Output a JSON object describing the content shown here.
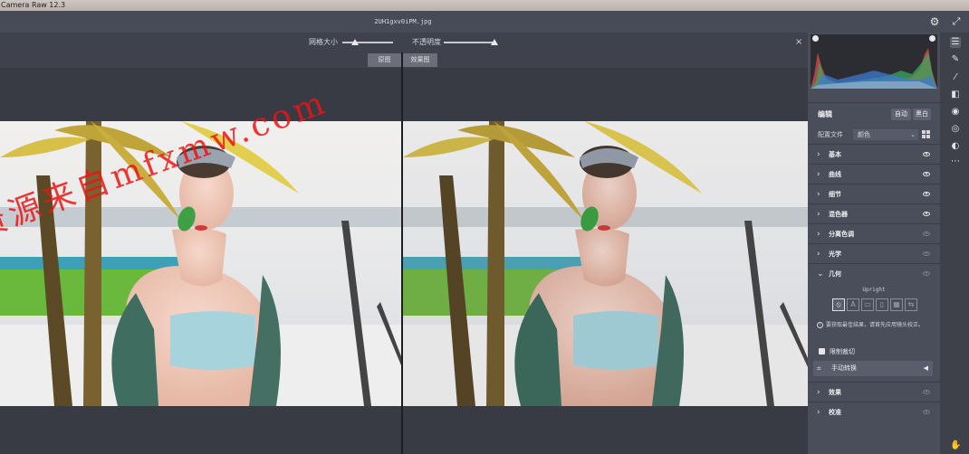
{
  "window": {
    "title": "Camera Raw 12.3",
    "filename": "2UH1gxv0iPM.jpg"
  },
  "header_icons": {
    "settings": "gear-icon",
    "fullscreen": "expand-icon"
  },
  "compare_bar": {
    "grid_size_label": "网格大小",
    "grid_size_value": 0.25,
    "opacity_label": "不透明度",
    "opacity_value": 1.0,
    "close_glyph": "×"
  },
  "view_buttons": {
    "before": "原图",
    "after": "效果图"
  },
  "watermark": "资源来自mfxmw.com",
  "edit_panel": {
    "title": "编辑",
    "auto_button": "自动",
    "bw_button": "黑白",
    "profile_label": "配置文件",
    "profile_value": "颜色",
    "sections": [
      {
        "label": "基本",
        "expanded": false,
        "visible": true
      },
      {
        "label": "曲线",
        "expanded": false,
        "visible": true
      },
      {
        "label": "细节",
        "expanded": false,
        "visible": true
      },
      {
        "label": "混色器",
        "expanded": false,
        "visible": true
      },
      {
        "label": "分离色调",
        "expanded": false,
        "visible": false
      },
      {
        "label": "光学",
        "expanded": false,
        "visible": false
      },
      {
        "label": "几何",
        "expanded": true,
        "visible": false
      },
      {
        "label": "效果",
        "expanded": false,
        "visible": false
      },
      {
        "label": "校准",
        "expanded": false,
        "visible": false
      }
    ],
    "geometry": {
      "upright_label": "Upright",
      "upright_buttons": [
        "⦸",
        "A",
        "▭",
        "▯",
        "▦",
        "⇆"
      ],
      "info_text": "要获取最佳结果，请首先应用镜头校正。",
      "constrain_crop_label": "限制裁切",
      "constrain_crop_checked": true,
      "manual_transform_label": "手动转换"
    }
  },
  "toolbar_icons": [
    "edit-sliders-icon",
    "heal-brush-icon",
    "adjustment-brush-icon",
    "graduated-filter-icon",
    "radial-filter-icon",
    "red-eye-icon",
    "presets-icon",
    "more-icon",
    "hand-icon"
  ],
  "colors": {
    "panel_bg": "#4a4d5a",
    "header_bg": "#474a57",
    "watermark": "#eb1414"
  }
}
